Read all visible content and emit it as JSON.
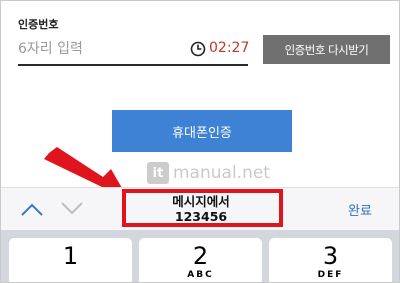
{
  "form": {
    "label": "인증번호",
    "placeholder": "6자리 입력",
    "timer": "02:27",
    "resend_label": "인증번호 다시받기",
    "verify_label": "휴대폰인증"
  },
  "watermark": {
    "logo": "it",
    "text": "manual.net"
  },
  "toolbar": {
    "suggestion_line1": "메시지에서",
    "suggestion_line2": "123456",
    "done_label": "완료"
  },
  "keyboard": {
    "keys": [
      {
        "digit": "1",
        "letters": ""
      },
      {
        "digit": "2",
        "letters": "ABC"
      },
      {
        "digit": "3",
        "letters": "DEF"
      }
    ]
  },
  "colors": {
    "timer": "#c0392b",
    "resend_button": "#707070",
    "verify_button": "#3d82d4",
    "highlight": "#e0141c",
    "arrow": "#e0141c",
    "done": "#2f6fc5"
  },
  "icons": [
    "clock-icon",
    "chevron-up-icon",
    "chevron-down-icon",
    "arrow-annotation"
  ]
}
